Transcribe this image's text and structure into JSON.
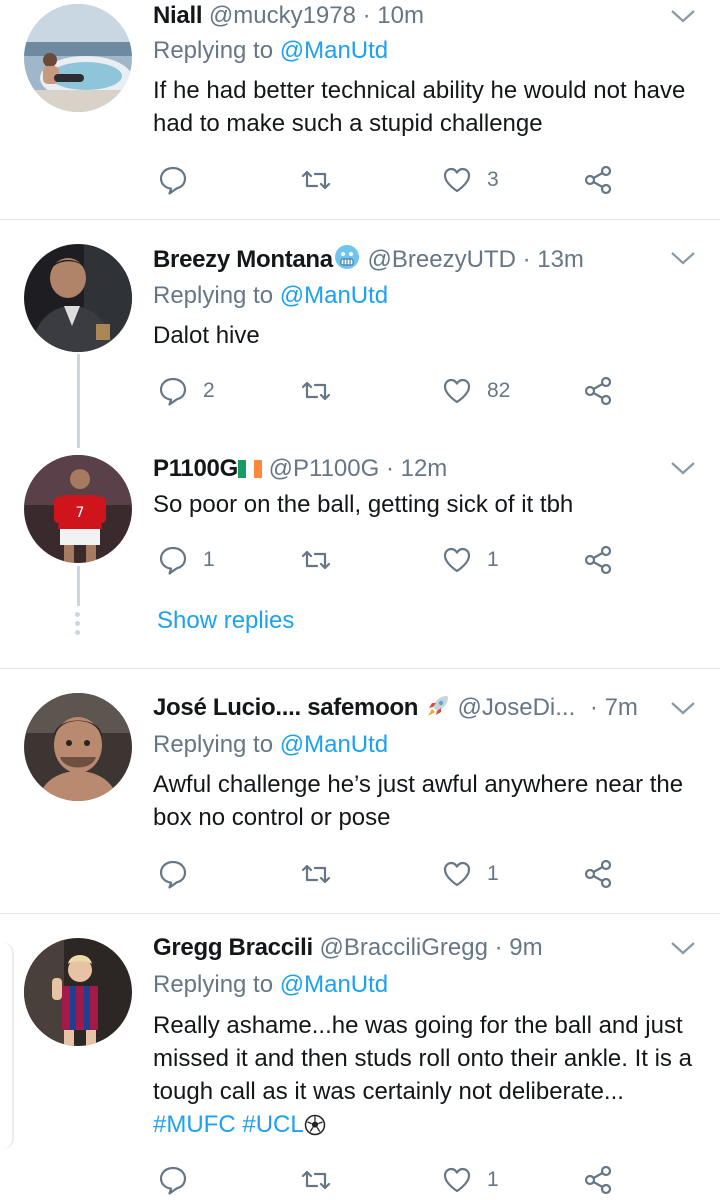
{
  "tweets": [
    {
      "name": "Niall",
      "handle": "@mucky1978",
      "time": "· 10m",
      "reply_prefix": "Replying to",
      "reply_to": "@ManUtd",
      "text": "If he had better technical ability he would not have had to make such a stupid challenge",
      "replies": "",
      "retweets": "",
      "likes": "3",
      "avatar_icon": "hot-tub-photo"
    },
    {
      "name": "Breezy Montana",
      "handle": "@BreezyUTD",
      "time": "· 13m",
      "reply_prefix": "Replying to",
      "reply_to": "@ManUtd",
      "text": "Dalot hive",
      "replies": "2",
      "retweets": "",
      "likes": "82",
      "avatar_icon": "man-in-suit-photo",
      "name_emoji": "cold-face-emoji"
    },
    {
      "name": "P1100G",
      "handle": "@P1100G",
      "time": "· 12m",
      "text": "So poor on the ball, getting sick of it tbh",
      "replies": "1",
      "retweets": "",
      "likes": "1",
      "avatar_icon": "footballer-red-kit-photo",
      "name_emoji": "ireland-flag-emoji",
      "show_replies": "Show replies"
    },
    {
      "name": "José Lucio.... safemoon",
      "handle": "@JoseDi...",
      "time": "· 7m",
      "reply_prefix": "Replying to",
      "reply_to": "@ManUtd",
      "text": "Awful challenge he’s just awful anywhere near the box no control or pose",
      "replies": "",
      "retweets": "",
      "likes": "1",
      "avatar_icon": "man-selfie-photo",
      "name_emoji": "rocket-emoji"
    },
    {
      "name": "Gregg Braccili",
      "handle": "@BracciliGregg",
      "time": "· 9m",
      "reply_prefix": "Replying to",
      "reply_to": "@ManUtd",
      "text": "Really ashame...he was going for the ball and just missed it and then studs roll onto their ankle. It is a tough call as it was certainly not deliberate...",
      "hashtags": [
        "#MUFC",
        "#UCL"
      ],
      "replies": "",
      "retweets": "",
      "likes": "1",
      "avatar_icon": "child-barcelona-kit-photo",
      "trailing_emoji": "soccer-ball-emoji"
    }
  ],
  "colors": {
    "accent": "#1da1f2",
    "secondary": "#657786",
    "divider": "#e1e8ed"
  }
}
